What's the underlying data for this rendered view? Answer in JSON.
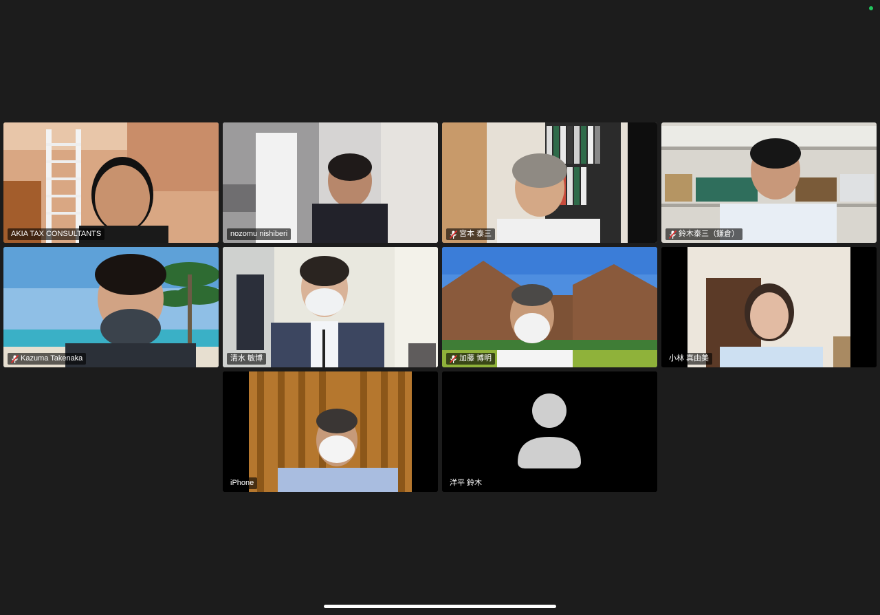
{
  "meeting": {
    "connection_indicator_color": "#22c55e",
    "active_speaker_border_color": "#39c85a",
    "participants": [
      {
        "name": "AKIA TAX CONSULTANTS",
        "muted": false,
        "active_speaker": true,
        "video": true
      },
      {
        "name": "nozomu nishiberi",
        "muted": false,
        "active_speaker": false,
        "video": true
      },
      {
        "name": "宮本 泰三",
        "muted": true,
        "active_speaker": false,
        "video": true
      },
      {
        "name": "鈴木泰三（鎌倉）",
        "muted": true,
        "active_speaker": false,
        "video": true
      },
      {
        "name": "Kazuma Takenaka",
        "muted": true,
        "active_speaker": false,
        "video": true
      },
      {
        "name": "清水 敏博",
        "muted": false,
        "active_speaker": false,
        "video": true
      },
      {
        "name": "加藤 博明",
        "muted": true,
        "active_speaker": false,
        "video": true
      },
      {
        "name": "小林 真由美",
        "muted": false,
        "active_speaker": false,
        "video": true
      },
      {
        "name": "iPhone",
        "muted": false,
        "active_speaker": false,
        "video": true
      },
      {
        "name": "洋平 鈴木",
        "muted": false,
        "active_speaker": false,
        "video": false
      }
    ]
  },
  "icons": {
    "muted": "mic-muted-icon",
    "no_video_avatar": "avatar-placeholder-icon"
  }
}
